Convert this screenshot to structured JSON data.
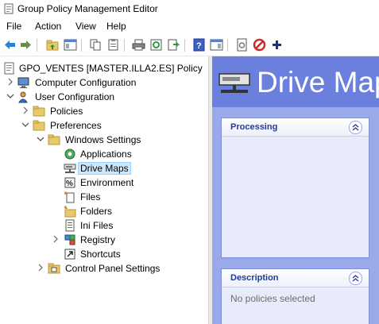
{
  "window": {
    "title": "Group Policy Management Editor"
  },
  "menu": [
    "File",
    "Action",
    "View",
    "Help"
  ],
  "toolbar": {
    "icons": [
      "back-icon",
      "forward-icon",
      "up-folder-icon",
      "show-hide-tree-icon",
      "copy-icon",
      "paste-icon",
      "print-icon",
      "refresh-icon",
      "export-list-icon",
      "help-icon",
      "show-hide-action-pane-icon",
      "properties-icon",
      "stop-icon",
      "add-icon"
    ]
  },
  "tree": {
    "root": "GPO_VENTES [MASTER.ILLA2.ES] Policy",
    "computer_configuration": "Computer Configuration",
    "user_configuration": "User Configuration",
    "policies": "Policies",
    "preferences": "Preferences",
    "windows_settings": "Windows Settings",
    "applications": "Applications",
    "drive_maps": "Drive Maps",
    "environment": "Environment",
    "files": "Files",
    "folders": "Folders",
    "ini_files": "Ini Files",
    "registry": "Registry",
    "shortcuts": "Shortcuts",
    "control_panel_settings": "Control Panel Settings"
  },
  "content": {
    "title": "Drive Maps",
    "processing_title": "Processing",
    "description_title": "Description",
    "description_text": "No policies selected"
  },
  "colors": {
    "header_bg": "#6b7fdc",
    "panel_area_bg": "#9aa9e8",
    "panel_bg": "#e8ecfa",
    "selection_bg": "#cce8ff"
  }
}
